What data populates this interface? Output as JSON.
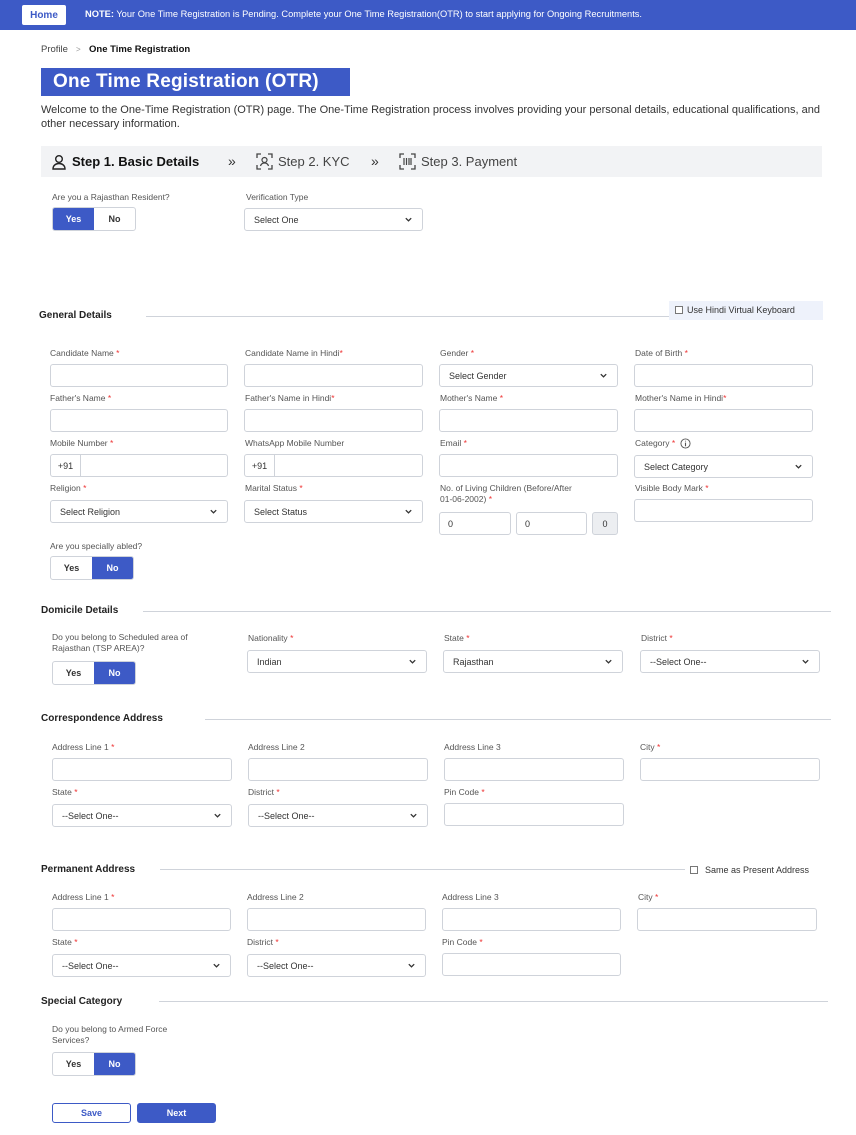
{
  "topbar": {
    "home_label": "Home",
    "note_prefix": "NOTE:",
    "note_text": " Your One Time Registration is Pending. Complete your One Time Registration(OTR) to start applying for Ongoing Recruitments."
  },
  "breadcrumb": {
    "parent": "Profile",
    "separator": ">",
    "current": "One Time Registration"
  },
  "page": {
    "title": "One Time Registration (OTR)",
    "intro": "Welcome to the One-Time Registration (OTR) page. The One-Time Registration process involves providing your personal details, educational qualifications, and other necessary information."
  },
  "steps": [
    {
      "label": "Step 1. Basic Details",
      "icon": "user-icon",
      "active": true
    },
    {
      "label": "Step 2. KYC",
      "icon": "face-scan-icon",
      "active": false
    },
    {
      "label": "Step 3. Payment",
      "icon": "barcode-icon",
      "active": false
    }
  ],
  "step_separator": "»",
  "resident": {
    "question": "Are you a Rajasthan Resident?",
    "yes": "Yes",
    "no": "No",
    "selected": "Yes",
    "verification_label": "Verification Type",
    "verification_value": "Select One"
  },
  "general": {
    "title": "General Details",
    "hindi_keyboard": "Use Hindi Virtual Keyboard",
    "candidate_name": "Candidate Name",
    "candidate_name_hindi": "Candidate Name in Hindi",
    "gender": "Gender",
    "gender_value": "Select Gender",
    "dob": "Date of Birth",
    "father_name": "Father's Name",
    "father_name_hindi": "Father's Name in Hindi",
    "mother_name": "Mother's Name",
    "mother_name_hindi": "Mother's Name in Hindi",
    "mobile": "Mobile Number",
    "mobile_prefix": "+91",
    "whatsapp": "WhatsApp Mobile Number",
    "whatsapp_prefix": "+91",
    "email": "Email",
    "category": "Category",
    "category_value": "Select Category",
    "religion": "Religion",
    "religion_value": "Select Religion",
    "marital": "Marital Status",
    "marital_value": "Select Status",
    "children_line1": "No. of Living Children (Before/After",
    "children_line2": "01-06-2002)",
    "children_before": "0",
    "children_after": "0",
    "children_total": "0",
    "body_mark": "Visible Body Mark",
    "specially_abled": "Are you specially abled?",
    "yes": "Yes",
    "no": "No",
    "selected": "No"
  },
  "domicile": {
    "title": "Domicile Details",
    "tsp_line1": "Do you belong to Scheduled area of",
    "tsp_line2": "Rajasthan (TSP AREA)?",
    "yes": "Yes",
    "no": "No",
    "selected": "No",
    "nationality": "Nationality",
    "nationality_value": "Indian",
    "state": "State",
    "state_value": "Rajasthan",
    "district": "District",
    "district_value": "--Select One--"
  },
  "correspondence": {
    "title": "Correspondence Address",
    "line1": "Address Line 1",
    "line2": "Address Line 2",
    "line3": "Address Line 3",
    "city": "City",
    "state": "State",
    "state_value": "--Select One--",
    "district": "District",
    "district_value": "--Select One--",
    "pin": "Pin Code"
  },
  "permanent": {
    "title": "Permanent Address",
    "same_as": "Same as Present Address",
    "line1": "Address Line 1",
    "line2": "Address Line 2",
    "line3": "Address Line 3",
    "city": "City",
    "state": "State",
    "state_value": "--Select One--",
    "district": "District",
    "district_value": "--Select One--",
    "pin": "Pin Code"
  },
  "special": {
    "title": "Special Category",
    "armed_line1": "Do you belong to Armed Force",
    "armed_line2": "Services?",
    "yes": "Yes",
    "no": "No",
    "selected": "No"
  },
  "actions": {
    "save": "Save",
    "next": "Next"
  },
  "required_mark": "*",
  "colors": {
    "primary": "#3d5ac6",
    "border": "#cfd3da",
    "required": "#e33"
  }
}
